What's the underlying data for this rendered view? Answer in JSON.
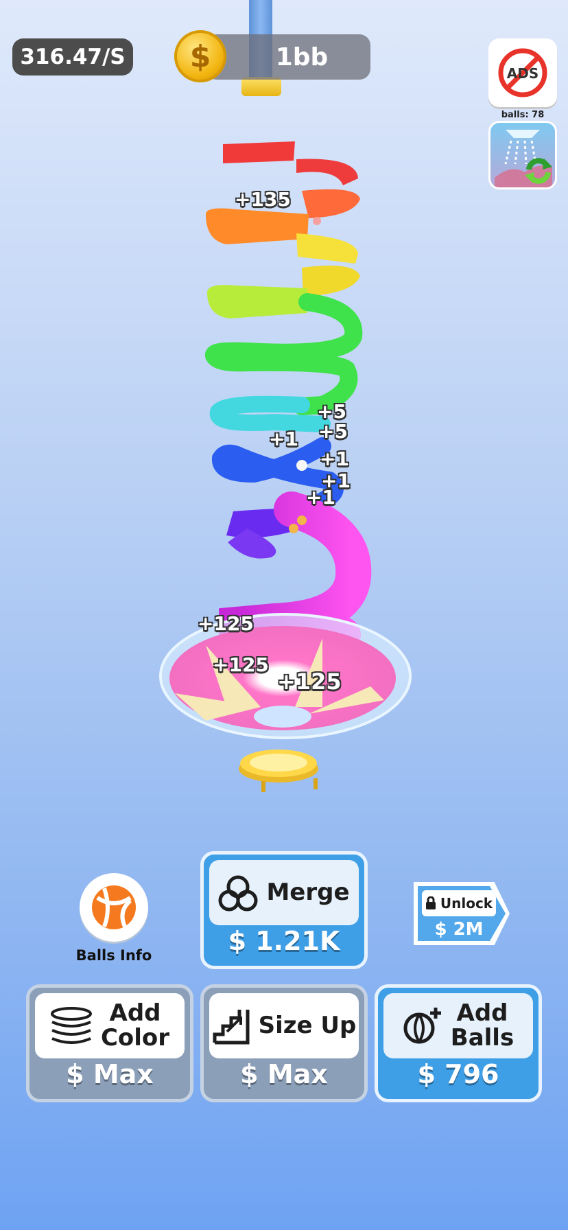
{
  "hud": {
    "income_rate": "316.47/S",
    "money": "1bb"
  },
  "side": {
    "ads_label": "ADS",
    "balls_count": "balls: 78"
  },
  "popups": [
    {
      "text": "+135",
      "kind": "stack"
    },
    {
      "text": "+5",
      "kind": "stack"
    },
    {
      "text": "+5",
      "kind": "stack"
    },
    {
      "text": "+1",
      "kind": "single"
    },
    {
      "text": "+1",
      "kind": "stack"
    },
    {
      "text": "+1",
      "kind": "stack"
    },
    {
      "text": "+1",
      "kind": "single"
    },
    {
      "text": "+125",
      "kind": "single"
    },
    {
      "text": "+125",
      "kind": "single"
    },
    {
      "text": "+125",
      "kind": "large"
    }
  ],
  "buttons": {
    "balls_info": "Balls Info",
    "merge": {
      "label": "Merge",
      "price": "$ 1.21K"
    },
    "unlock": {
      "label": "Unlock",
      "price": "$ 2M"
    },
    "add_color": {
      "label_line1": "Add",
      "label_line2": "Color",
      "price": "$ Max"
    },
    "size_up": {
      "label": "Size Up",
      "price": "$ Max"
    },
    "add_balls": {
      "label_line1": "Add",
      "label_line2": "Balls",
      "price": "$ 796"
    }
  },
  "colors": {
    "rail_red": "#f03a3a",
    "rail_orange": "#ff8a2a",
    "rail_yellow": "#f3e036",
    "rail_lime": "#b8ec3a",
    "rail_green": "#3fe24a",
    "rail_cyan": "#43d8e0",
    "rail_blue": "#2b5ef0",
    "rail_violet": "#6a2bf0",
    "rail_magenta": "#e83ae6",
    "funnel_pink": "#f26fc2",
    "trampoline": "#ffd84a",
    "button_blue": "#3e9ee6",
    "button_grey": "#8b9fb8"
  },
  "icons": [
    "coin-icon",
    "no-ads-icon",
    "ball-rain-icon",
    "refresh-icon",
    "beach-ball-icon",
    "merge-circles-icon",
    "lock-icon",
    "stack-layers-icon",
    "stairs-up-icon",
    "ball-plus-icon"
  ]
}
